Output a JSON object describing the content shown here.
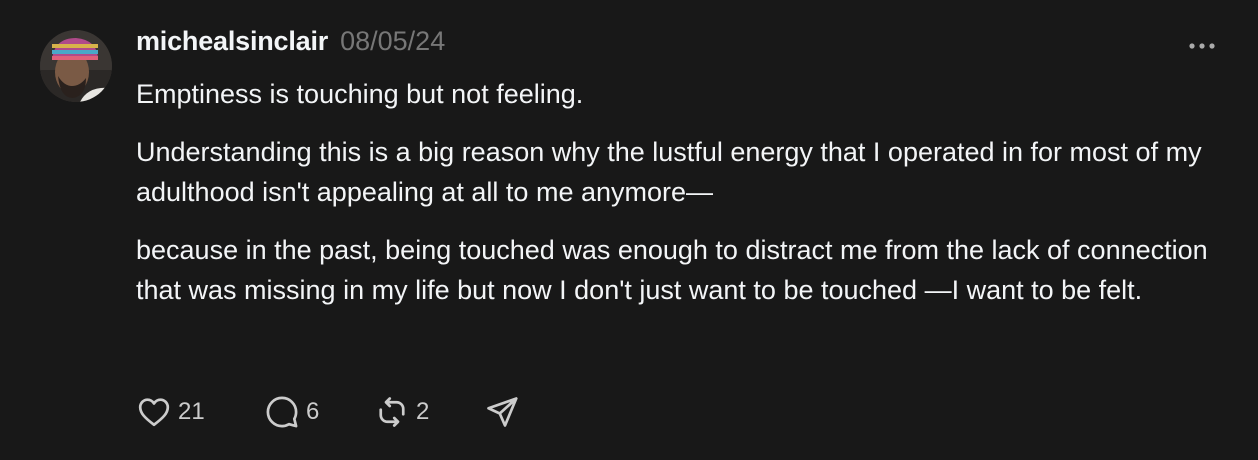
{
  "post": {
    "username": "michealsinclair",
    "timestamp": "08/05/24",
    "paragraphs": [
      "Emptiness is touching but not feeling.",
      "Understanding this is a big reason why the lustful energy that I operated in for most of my adulthood isn't appealing at all to me anymore—",
      "because in the past, being touched was enough to distract me from the lack of connection that was missing in my life but now I don't just want to be touched —I want to be felt."
    ],
    "actions": {
      "like_count": "21",
      "reply_count": "6",
      "repost_count": "2"
    },
    "icons": {
      "avatar": "profile-photo",
      "more": "more-options-icon",
      "like": "heart-icon",
      "reply": "comment-bubble-icon",
      "repost": "repost-arrows-icon",
      "share": "send-icon"
    },
    "colors": {
      "background": "#181818",
      "text": "#f3f5f7",
      "muted": "#777777"
    }
  }
}
